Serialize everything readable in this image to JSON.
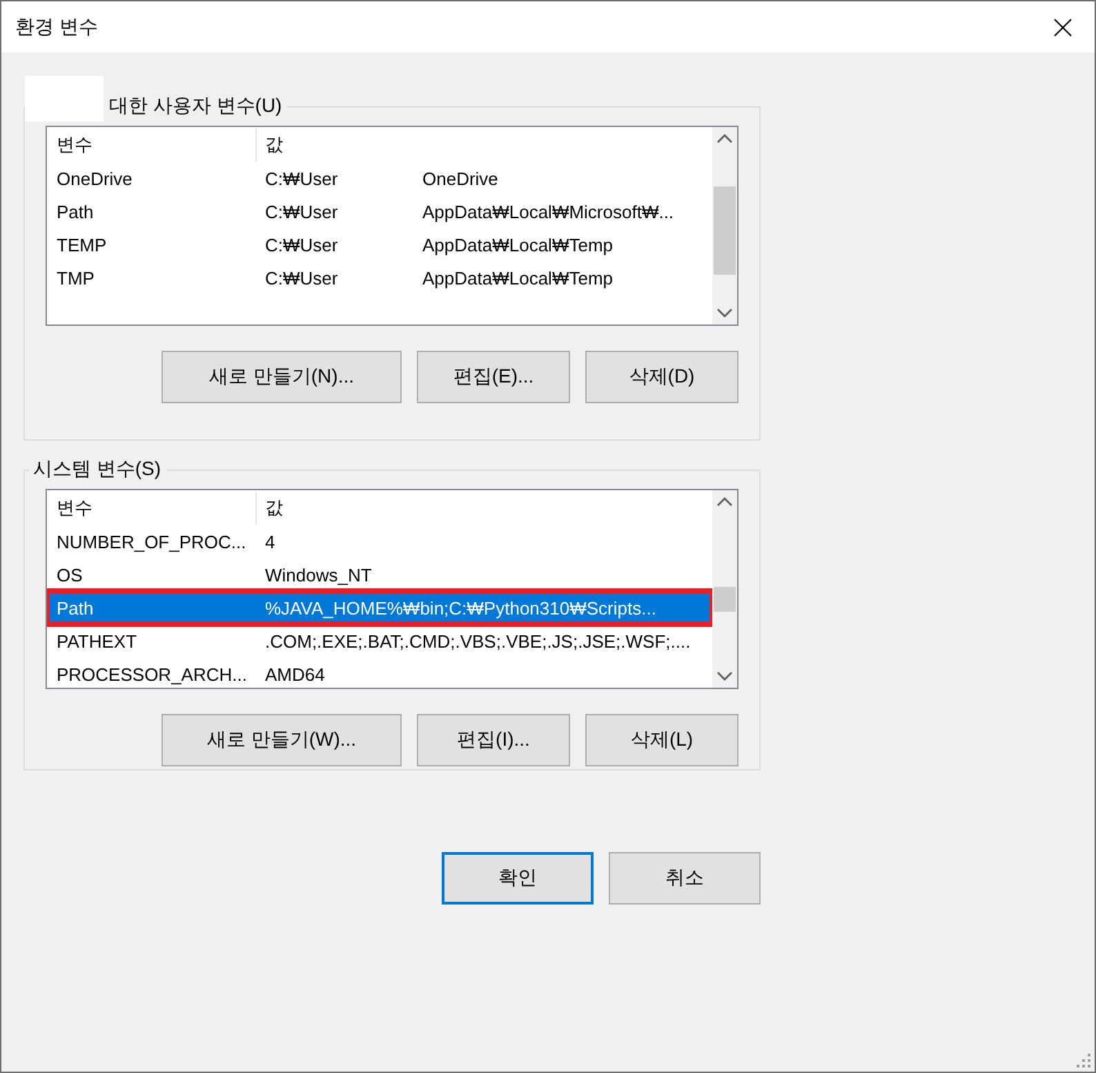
{
  "window": {
    "title": "환경 변수"
  },
  "user_group": {
    "label": "대한 사용자 변수(U)",
    "columns": [
      "변수",
      "값"
    ],
    "rows": [
      {
        "name": "OneDrive",
        "value_start": "C:₩User",
        "value_end": "OneDrive",
        "selected": false
      },
      {
        "name": "Path",
        "value_start": "C:₩User",
        "value_end": "AppData₩Local₩Microsoft₩...",
        "selected": false
      },
      {
        "name": "TEMP",
        "value_start": "C:₩User",
        "value_end": "AppData₩Local₩Temp",
        "selected": false
      },
      {
        "name": "TMP",
        "value_start": "C:₩User",
        "value_end": "AppData₩Local₩Temp",
        "selected": false
      }
    ],
    "buttons": [
      "새로 만들기(N)...",
      "편집(E)...",
      "삭제(D)"
    ]
  },
  "system_group": {
    "label": "시스템 변수(S)",
    "columns": [
      "변수",
      "값"
    ],
    "rows": [
      {
        "name": "NUMBER_OF_PROC...",
        "value": "4",
        "selected": false,
        "outlined": false
      },
      {
        "name": "OS",
        "value": "Windows_NT",
        "selected": false,
        "outlined": false
      },
      {
        "name": "Path",
        "value": "%JAVA_HOME%₩bin;C:₩Python310₩Scripts...",
        "selected": true,
        "outlined": true
      },
      {
        "name": "PATHEXT",
        "value": ".COM;.EXE;.BAT;.CMD;.VBS;.VBE;.JS;.JSE;.WSF;....",
        "selected": false,
        "outlined": false
      },
      {
        "name": "PROCESSOR_ARCH...",
        "value": "AMD64",
        "selected": false,
        "outlined": false
      }
    ],
    "buttons": [
      "새로 만들기(W)...",
      "편집(I)...",
      "삭제(L)"
    ]
  },
  "footer_buttons": [
    {
      "label": "확인",
      "default": true
    },
    {
      "label": "취소",
      "default": false
    }
  ]
}
